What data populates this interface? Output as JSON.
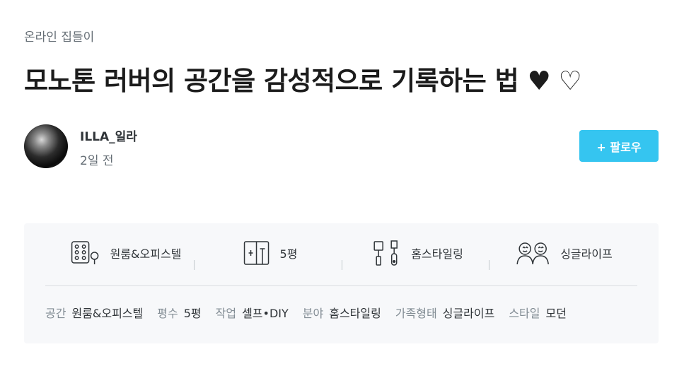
{
  "category": "온라인 집들이",
  "title": "모노톤 러버의 공간을 감성적으로 기록하는 법",
  "title_hearts": "♥ ♡",
  "author": {
    "name": "ILLA_일라",
    "date": "2일 전",
    "follow_label": "+ 팔로우"
  },
  "summary": [
    {
      "icon": "room-icon",
      "label": "원룸&오피스텔"
    },
    {
      "icon": "floor-plan-icon",
      "label": "5평"
    },
    {
      "icon": "paint-tools-icon",
      "label": "홈스타일링"
    },
    {
      "icon": "people-icon",
      "label": "싱글라이프"
    }
  ],
  "details": [
    {
      "key": "공간",
      "value": "원룸&오피스텔"
    },
    {
      "key": "평수",
      "value": "5평"
    },
    {
      "key": "작업",
      "value": "셀프•DIY"
    },
    {
      "key": "분야",
      "value": "홈스타일링"
    },
    {
      "key": "가족형태",
      "value": "싱글라이프"
    },
    {
      "key": "스타일",
      "value": "모던"
    }
  ],
  "colors": {
    "accent": "#35c5f0",
    "text_primary": "#2f3438",
    "text_secondary": "#828c94",
    "box_background": "#f7f8fa"
  }
}
